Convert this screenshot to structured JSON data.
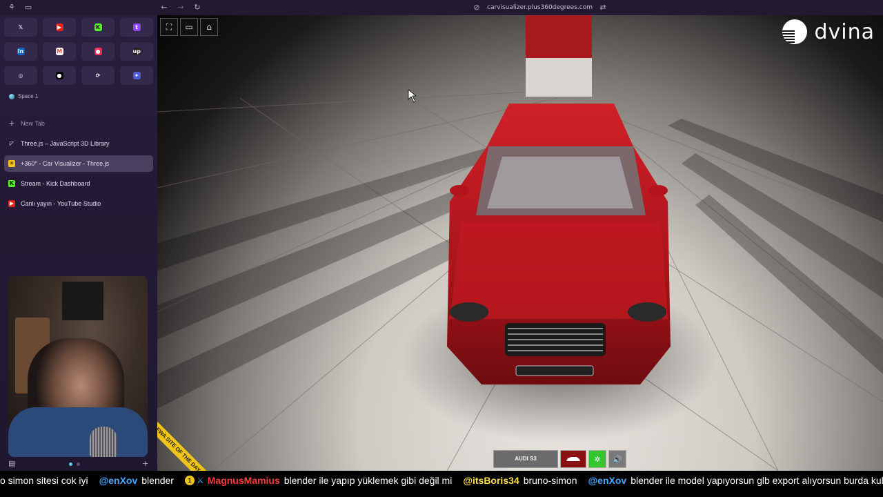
{
  "browser": {
    "url": "carvisualizer.plus360degrees.com"
  },
  "sidebar": {
    "favorites": [
      {
        "icon": "x-icon",
        "glyph": "𝕏",
        "color": "#ffffff",
        "bg": "transparent"
      },
      {
        "icon": "youtube-icon",
        "glyph": "▶",
        "color": "#ffffff",
        "bg": "#e62117"
      },
      {
        "icon": "kick-icon",
        "glyph": "K",
        "color": "#111111",
        "bg": "#53fc18"
      },
      {
        "icon": "twitch-icon",
        "glyph": "t",
        "color": "#ffffff",
        "bg": "#9146ff"
      },
      {
        "icon": "linkedin-icon",
        "glyph": "in",
        "color": "#ffffff",
        "bg": "#0a66c2"
      },
      {
        "icon": "gmail-icon",
        "glyph": "M",
        "color": "#ea4335",
        "bg": "#ffffff"
      },
      {
        "icon": "recorder-icon",
        "glyph": "●",
        "color": "#ffffff",
        "bg": "#ff2a55"
      },
      {
        "icon": "upwork-icon",
        "glyph": "up",
        "color": "#ffffff",
        "bg": "#222222"
      },
      {
        "icon": "globe-icon",
        "glyph": "◎",
        "color": "#d7d2e6",
        "bg": "transparent"
      },
      {
        "icon": "circle-icon",
        "glyph": "●",
        "color": "#ffffff",
        "bg": "#000000"
      },
      {
        "icon": "sync-icon",
        "glyph": "⟳",
        "color": "#ffffff",
        "bg": "transparent"
      },
      {
        "icon": "compass-icon",
        "glyph": "✦",
        "color": "#ffffff",
        "bg": "#4f5bd5"
      }
    ],
    "space_label": "Space 1",
    "new_tab_label": "New Tab",
    "tabs": [
      {
        "label": "Three.js – JavaScript 3D Library",
        "icon": "threejs-icon",
        "glyph": "◸",
        "color": "#ffffff",
        "bg": "transparent"
      },
      {
        "label": "+360° - Car Visualizer - Three.js",
        "icon": "car-visualizer-icon",
        "glyph": "✳",
        "color": "#111111",
        "bg": "#f0c419"
      },
      {
        "label": "Stream - Kick Dashboard",
        "icon": "kick-icon",
        "glyph": "K",
        "color": "#111111",
        "bg": "#53fc18"
      },
      {
        "label": "Canlı yayın - YouTube Studio",
        "icon": "youtube-icon",
        "glyph": "▶",
        "color": "#ffffff",
        "bg": "#e62117"
      }
    ]
  },
  "viewport": {
    "logo_text": "dvina",
    "model_label": "AUDI S3",
    "badge_text": "FWA SITE OF THE DAY",
    "car_color": "#b8141b"
  },
  "ticker": {
    "lead_text": "o simon sitesi cok iyi",
    "messages": [
      {
        "user": "@enXov",
        "user_color": "#4aa8ff",
        "text": "blender",
        "badges": []
      },
      {
        "user": "MagnusMamius",
        "user_color": "#ff3b3b",
        "text": "blender ile yapıp yüklemek gibi değil mi",
        "badges": [
          "1",
          "sword"
        ]
      },
      {
        "user": "@itsBoris34",
        "user_color": "#ffe14a",
        "text": "bruno-simon",
        "badges": []
      },
      {
        "user": "@enXov",
        "user_color": "#4aa8ff",
        "text": "blender ile model yapıyorsun glb export alıyorsun burda kullanıyorsun",
        "badges": []
      }
    ]
  }
}
